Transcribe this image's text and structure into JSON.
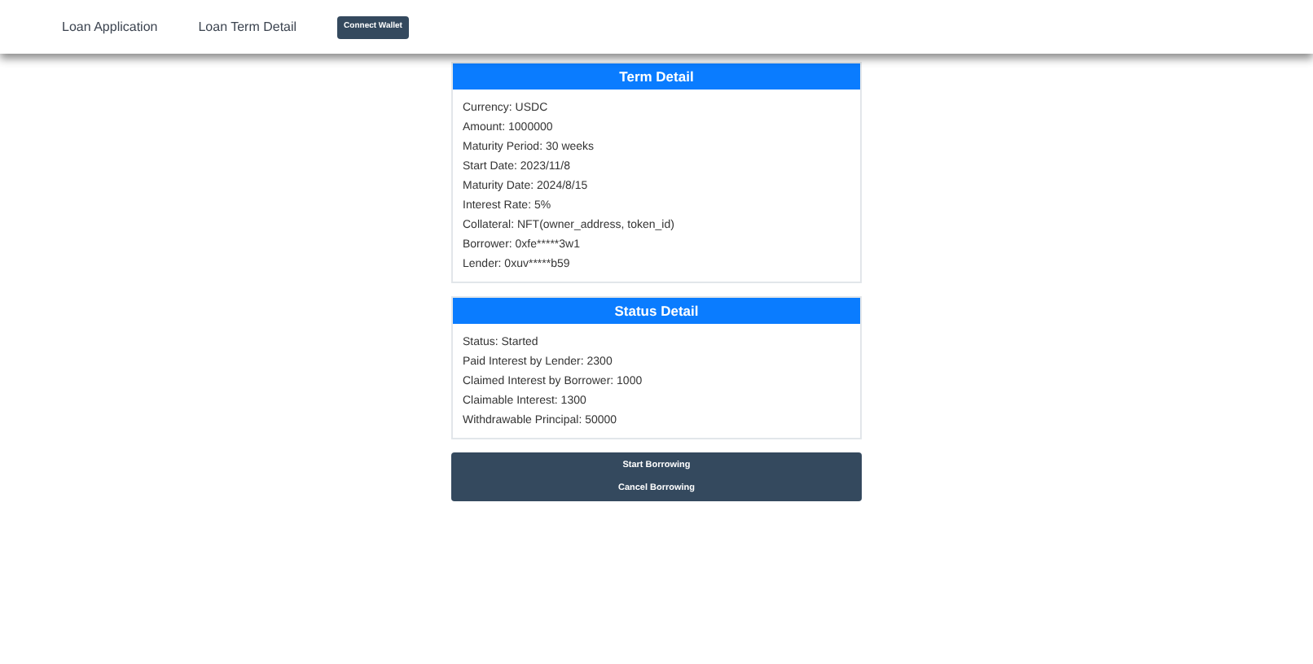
{
  "nav": {
    "links": [
      "Loan Application",
      "Loan Term Detail"
    ],
    "connect_button": "Connect Wallet"
  },
  "cards": [
    {
      "title": "Term Detail",
      "lines": [
        "Currency: USDC",
        "Amount: 1000000",
        "Maturity Period: 30 weeks",
        "Start Date: 2023/11/8",
        "Maturity Date: 2024/8/15",
        "Interest Rate: 5%",
        "Collateral: NFT(owner_address, token_id)",
        "Borrower: 0xfe*****3w1",
        "Lender: 0xuv*****b59"
      ]
    },
    {
      "title": "Status Detail",
      "lines": [
        "Status: Started",
        "Paid Interest by Lender: 2300",
        "Claimed Interest by Borrower: 1000",
        "Claimable Interest: 1300",
        "Withdrawable Principal: 50000"
      ]
    }
  ],
  "actions": [
    "Start Borrowing",
    "Cancel Borrowing"
  ]
}
